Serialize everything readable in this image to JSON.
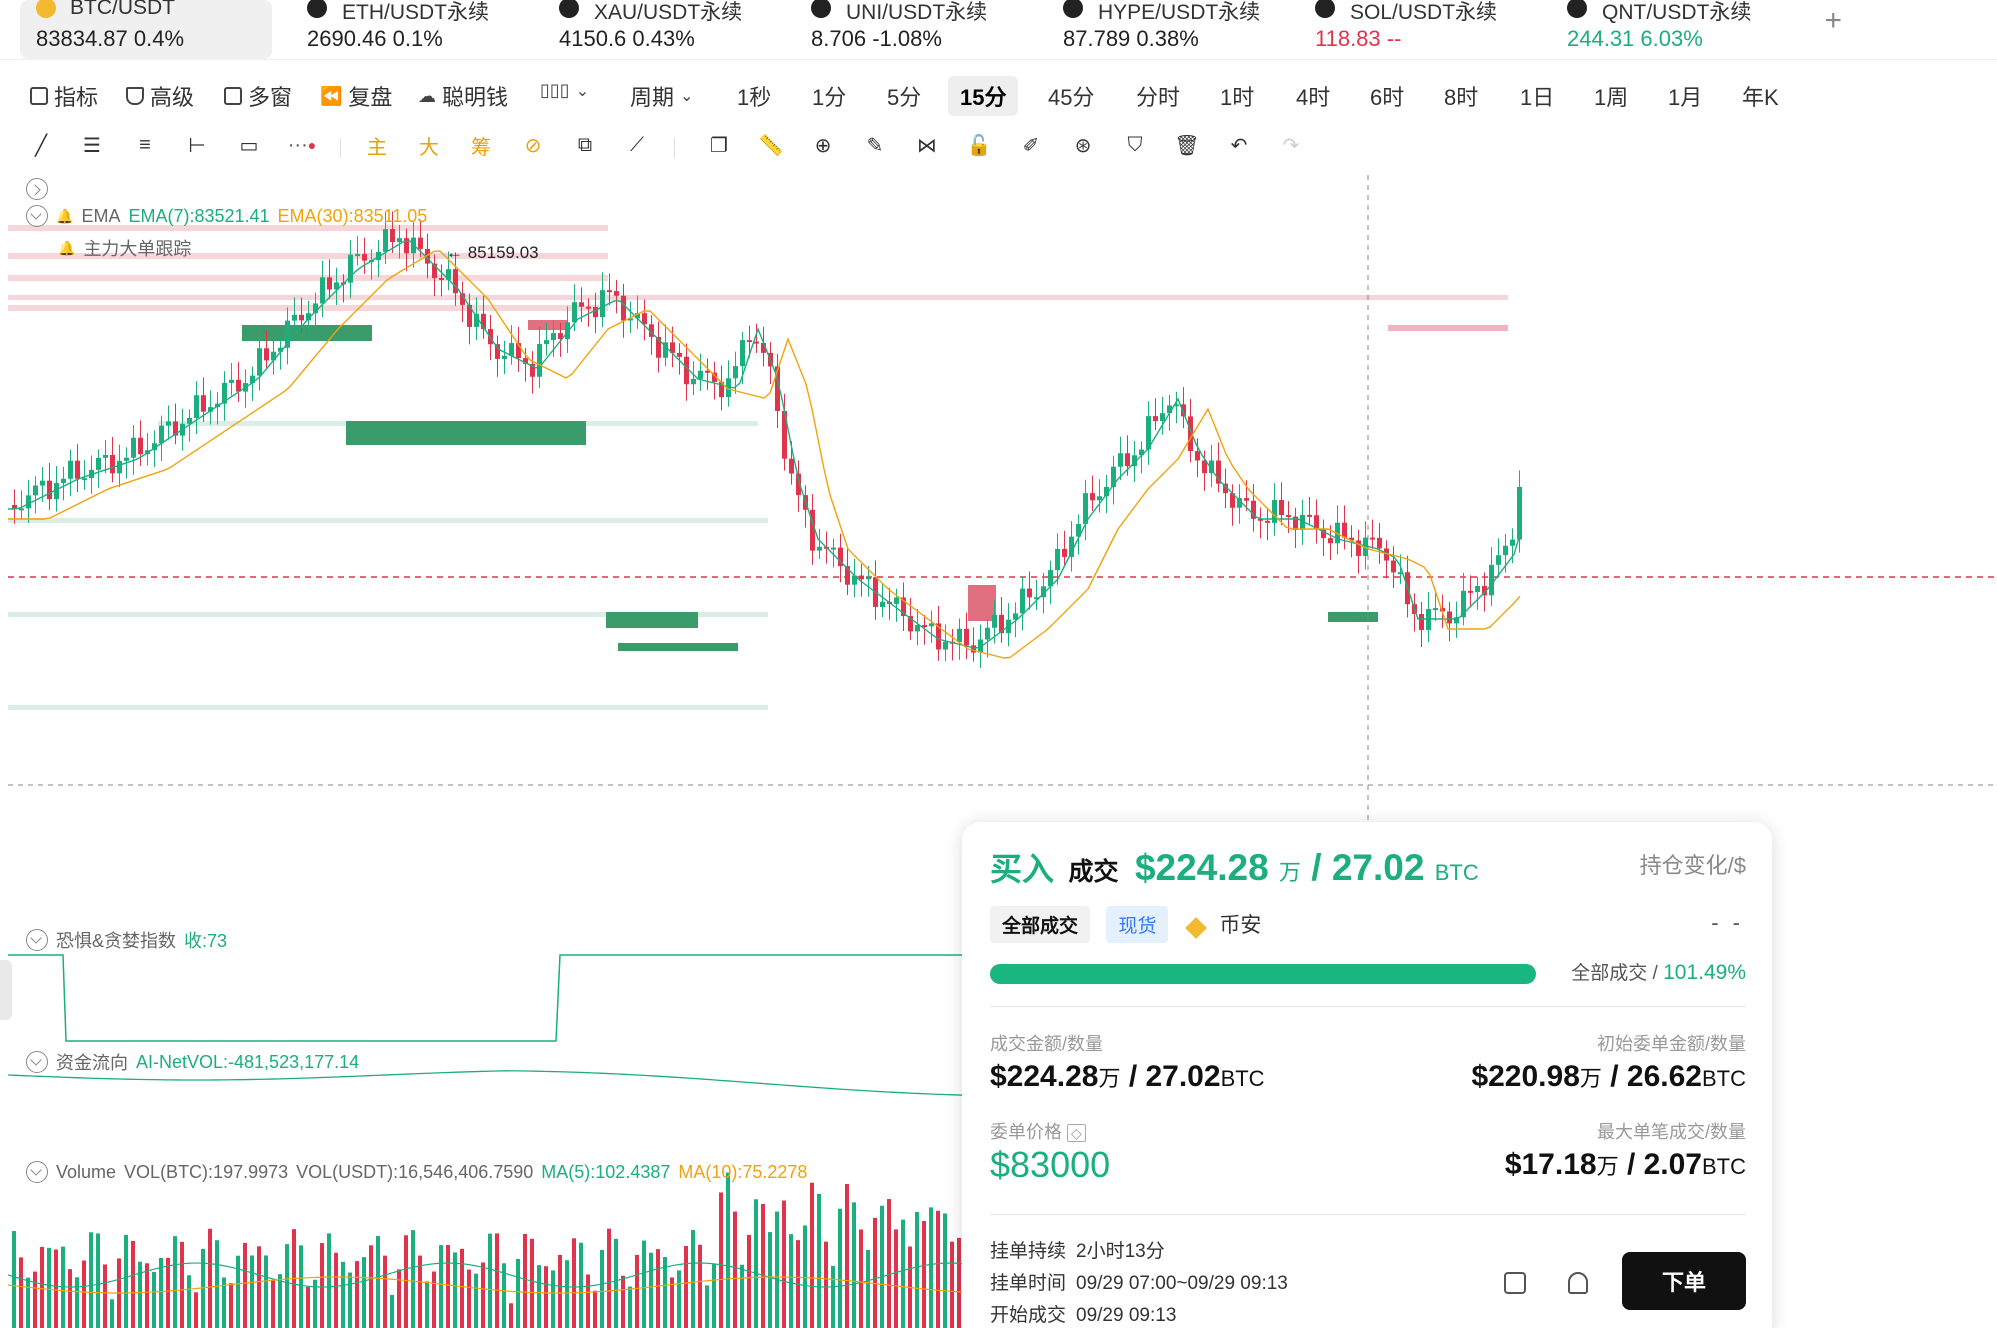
{
  "tickers": [
    {
      "name": "BTC/USDT",
      "price": "83834.87",
      "change": "0.4%",
      "dir": "neutral",
      "active": true
    },
    {
      "name": "ETH/USDT永续",
      "price": "2690.46",
      "change": "0.1%",
      "dir": "neutral"
    },
    {
      "name": "XAU/USDT永续",
      "price": "4150.6",
      "change": "0.43%",
      "dir": "neutral"
    },
    {
      "name": "UNI/USDT永续",
      "price": "8.706",
      "change": "-1.08%",
      "dir": "neutral"
    },
    {
      "name": "HYPE/USDT永续",
      "price": "87.789",
      "change": "0.38%",
      "dir": "neutral"
    },
    {
      "name": "SOL/USDT永续",
      "price": "118.83",
      "change": "--",
      "dir": "down"
    },
    {
      "name": "QNT/USDT永续",
      "price": "244.31",
      "change": "6.03%",
      "dir": "up"
    }
  ],
  "add_tab": "+",
  "toolbar": {
    "indicators": "指标",
    "advanced": "高级",
    "multi_window": "多窗",
    "replay": "复盘",
    "smart_money": "聪明钱",
    "cycle": "周期",
    "periods": [
      "1秒",
      "1分",
      "5分",
      "15分",
      "45分",
      "分时",
      "1时",
      "4时",
      "6时",
      "8时",
      "1日",
      "1周",
      "1月",
      "年K"
    ],
    "active_period": "15分"
  },
  "draw_tools": {
    "gold_labels": [
      "主",
      "大",
      "筹"
    ]
  },
  "chart": {
    "ema_label": "EMA",
    "ema7": "EMA(7):83521.41",
    "ema30": "EMA(30):83511.05",
    "main_force": "主力大单跟踪",
    "high_label": "← 85159.03",
    "fear_greed_label": "恐惧&贪婪指数",
    "fear_greed_value": "收:73",
    "fund_flow_label": "资金流向",
    "fund_flow_value": "AI-NetVOL:-481,523,177.14",
    "volume_label": "Volume",
    "vol_btc": "VOL(BTC):197.9973",
    "vol_usdt": "VOL(USDT):16,546,406.7590",
    "ma5": "MA(5):102.4387",
    "ma10": "MA(10):75.2278",
    "colors": {
      "up": "#1bae7f",
      "down": "#e0344d",
      "ema7": "#1bae7f",
      "ema30": "#f2a20c"
    }
  },
  "chart_data": {
    "type": "candlestick",
    "title": "BTC/USDT 15分",
    "ylabel": "",
    "xlabel": "",
    "high_marker": 85159.03,
    "ema7": 83521.41,
    "ema30": 83511.05,
    "current_price": 83834.87,
    "order_price": 83000
  },
  "trade_card": {
    "side": "买入",
    "deal": "成交",
    "amount": "$224.28",
    "amount_unit": "万",
    "qty": "/ 27.02",
    "qty_unit": "BTC",
    "position_change": "持仓变化/$",
    "tag_all": "全部成交",
    "tag_spot": "现货",
    "exchange": "币安",
    "dashes": "- -",
    "progress_label": "全部成交",
    "progress_sep": "/",
    "progress_pct": "101.49%",
    "progress_value": 1.0,
    "deal_amount_label": "成交金额/数量",
    "deal_amount": "$224.28",
    "deal_amount_unit": "万",
    "deal_qty": "/ 27.02",
    "deal_qty_unit": "BTC",
    "init_label": "初始委单金额/数量",
    "init_amount": "$220.98",
    "init_unit": "万",
    "init_qty": "/ 26.62",
    "init_qty_unit": "BTC",
    "order_price_label": "委单价格",
    "order_price": "$83000",
    "max_label": "最大单笔成交/数量",
    "max_amount": "$17.18",
    "max_unit": "万",
    "max_qty": "/ 2.07",
    "max_qty_unit": "BTC",
    "duration_label": "挂单持续",
    "duration": "2小时13分",
    "order_time_label": "挂单时间",
    "order_time": "09/29 07:00~09/29 09:13",
    "start_label": "开始成交",
    "start_time": "09/29 09:13",
    "order_button": "下单"
  }
}
